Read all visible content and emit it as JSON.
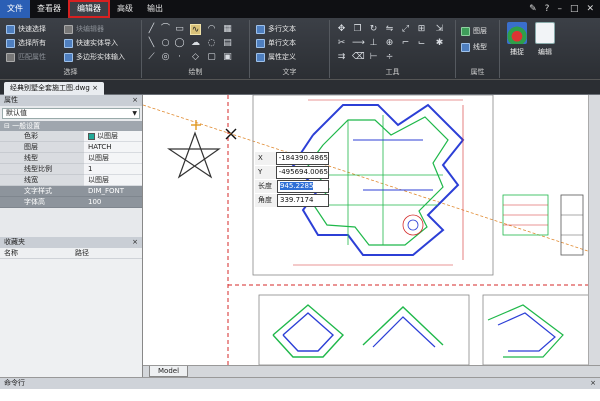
{
  "menu": {
    "file": "文件",
    "tabs": [
      "查看器",
      "编辑器",
      "高级",
      "输出"
    ]
  },
  "ribbon": {
    "select_panel": {
      "title": "选择",
      "items": [
        "快速选择",
        "选择所有",
        "匹配属性"
      ],
      "items2": [
        "块编辑器",
        "快速实体导入",
        "多边形实体输入"
      ]
    },
    "draw_panel": {
      "title": "绘制"
    },
    "text_panel": {
      "title": "文字",
      "items": [
        "多行文本",
        "单行文本",
        "属性定义"
      ]
    },
    "tools_panel": {
      "title": "工具"
    },
    "props_panel": {
      "title": "属性",
      "items": [
        "图层",
        "线型"
      ]
    },
    "big_buttons": [
      "捕捉",
      "编辑"
    ]
  },
  "document": {
    "tab_name": "经典别墅全套施工图.dwg"
  },
  "properties": {
    "header": "属性",
    "dropdown": "默认值",
    "group": "一般设置",
    "rows": [
      {
        "k": "色彩",
        "v": "以图层"
      },
      {
        "k": "图层",
        "v": "HATCH"
      },
      {
        "k": "线型",
        "v": "以图层"
      },
      {
        "k": "线型比例",
        "v": "1"
      },
      {
        "k": "线宽",
        "v": "以图层"
      },
      {
        "k": "文字样式",
        "v": "DIM_FONT"
      },
      {
        "k": "字体高",
        "v": "100"
      }
    ]
  },
  "favorites": {
    "header": "收藏夹",
    "col_name": "名称",
    "col_path": "路径"
  },
  "coord_input": {
    "x_label": "X",
    "x_value": "-184390.4865",
    "y_label": "Y",
    "y_value": "-495694.0065",
    "len_label": "长度",
    "len_value": "945.2285",
    "angle_label": "角度",
    "angle_value": "339.7174"
  },
  "model_tab": "Model",
  "command_line": {
    "header": "命令行",
    "text": ""
  },
  "colors": {
    "menu_bg": "#0f1013",
    "ribbon_bg": "#2b2e33",
    "highlight_red": "#d62020",
    "cad_green": "#1fb84a",
    "cad_blue": "#2c3fd6",
    "cad_red": "#d42a2a"
  }
}
